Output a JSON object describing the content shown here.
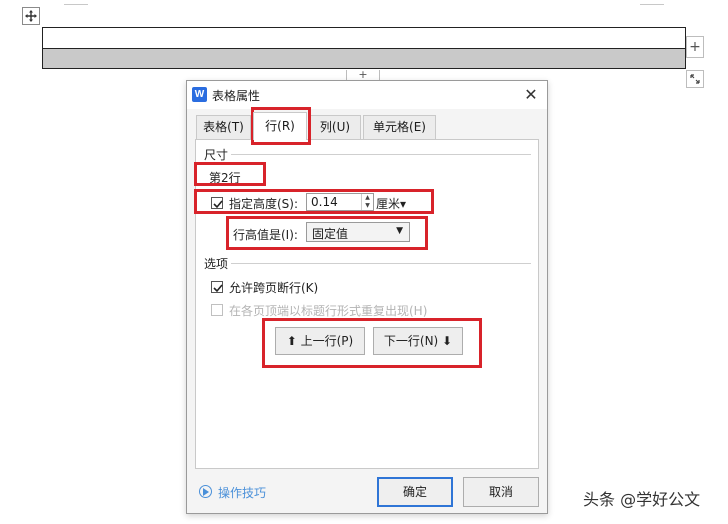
{
  "document": {
    "add_column_glyph": "+",
    "add_row_glyph": "+"
  },
  "dialog": {
    "title": "表格属性",
    "app_icon_letter": "W",
    "close_glyph": "✕",
    "tabs": [
      {
        "label": "表格(T)",
        "active": false
      },
      {
        "label": "行(R)",
        "active": true
      },
      {
        "label": "列(U)",
        "active": false
      },
      {
        "label": "单元格(E)",
        "active": false
      }
    ],
    "size_section": {
      "heading": "尺寸",
      "row_label": "第2行",
      "specify_height": {
        "checked": true,
        "label": "指定高度(S):",
        "value": "0.14",
        "unit": "厘米▾"
      },
      "height_rule": {
        "label": "行高值是(I):",
        "value": "固定值"
      }
    },
    "options_section": {
      "heading": "选项",
      "allow_break": {
        "checked": true,
        "label": "允许跨页断行(K)"
      },
      "repeat_header": {
        "checked": false,
        "enabled": false,
        "label": "在各页顶端以标题行形式重复出现(H)"
      }
    },
    "prev_row_button": "⬆ 上一行(P)",
    "next_row_button": "下一行(N) ⬇",
    "tips_link": "操作技巧",
    "ok_button": "确定",
    "cancel_button": "取消"
  },
  "watermark": "头条 @学好公文",
  "colors": {
    "highlight": "#d8232a",
    "accent": "#2f75d6",
    "link": "#4a90d9",
    "app_icon": "#2a6de0"
  }
}
